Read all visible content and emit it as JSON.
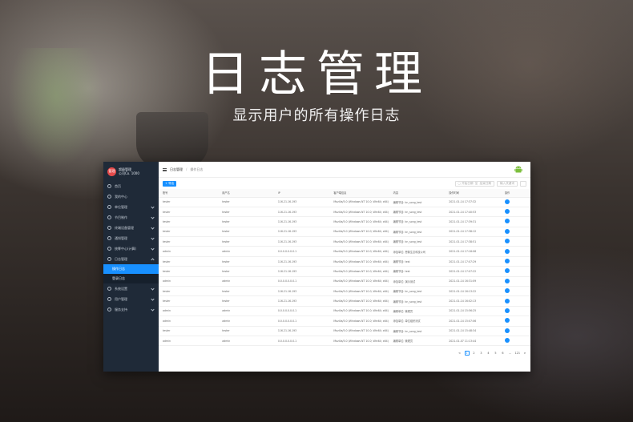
{
  "hero": {
    "title": "日志管理",
    "subtitle": "显示用户的所有操作日志"
  },
  "user": {
    "avatar": "管理",
    "name": "超级管理",
    "role": "公司Co. 1000"
  },
  "sidebar": {
    "items": [
      {
        "label": "首页"
      },
      {
        "label": "我的中心"
      },
      {
        "label": "单位管理"
      },
      {
        "label": "节目制作"
      },
      {
        "label": "终端设备管理"
      },
      {
        "label": "通知管理"
      },
      {
        "label": "统筹中心(计算)"
      },
      {
        "label": "日志管理"
      }
    ],
    "sub": [
      {
        "label": "操作日志"
      },
      {
        "label": "登录日志"
      }
    ],
    "items2": [
      {
        "label": "系统设置"
      },
      {
        "label": "用户管理"
      },
      {
        "label": "服务支持"
      }
    ]
  },
  "breadcrumb": {
    "first": "日志管理",
    "sep": "/",
    "second": "操作日志"
  },
  "toolbar": {
    "export_label": "+ 导出",
    "start_placeholder": "开始日期",
    "to_label": "至",
    "end_placeholder": "结束日期",
    "search_placeholder": "输入关键词"
  },
  "table": {
    "headers": [
      "账号",
      "用户名",
      "IP",
      "客户端信息",
      "内容",
      "操作时间",
      "操作"
    ],
    "rows": [
      [
        "tester",
        "tester",
        "116.21.16.193",
        "Mozilla/5.0 (Windows NT 10.0; Win64; x64) App...",
        "编辑节目: kn_song_test",
        "2021-01-14 17:37:32"
      ],
      [
        "tester",
        "tester",
        "116.21.16.193",
        "Mozilla/5.0 (Windows NT 10.0; Win64; x64) App...",
        "编辑节目: kn_song_test",
        "2021-01-14 17:40:53"
      ],
      [
        "tester",
        "tester",
        "116.21.16.193",
        "Mozilla/5.0 (Windows NT 10.0; Win64; x64) App...",
        "编辑节目: kn_song_test",
        "2021-01-14 17:39:31"
      ],
      [
        "tester",
        "tester",
        "116.21.16.193",
        "Mozilla/5.0 (Windows NT 10.0; Win64; x64) App...",
        "编辑节目: kn_song_test",
        "2021-01-14 17:38:12"
      ],
      [
        "tester",
        "tester",
        "116.21.16.193",
        "Mozilla/5.0 (Windows NT 10.0; Win64; x64) App...",
        "编辑节目: kn_song_test",
        "2021-01-14 17:38:51"
      ],
      [
        "admin",
        "admin",
        "0.0.0.0.0.0.0.1",
        "Mozilla/5.0 (Windows NT 10.0; Win64; x64) App...",
        "添加单位: 恩普生意科技公司",
        "2021-01-14 17:18:06"
      ],
      [
        "tester",
        "tester",
        "116.21.16.193",
        "Mozilla/5.0 (Windows NT 10.0; Win64; x64) App...",
        "编辑节目: test",
        "2021-01-14 17:07:29"
      ],
      [
        "tester",
        "tester",
        "116.21.16.193",
        "Mozilla/5.0 (Windows NT 10.0; Win64; x64) App...",
        "编辑节目: test",
        "2021-01-14 17:07:22"
      ],
      [
        "admin",
        "admin",
        "0.0.0.0.0.0.0.1",
        "Mozilla/5.0 (Windows NT 10.0; Win64; x64) App...",
        "添加单位: 演示测试",
        "2021-01-14 16:31:09"
      ],
      [
        "tester",
        "tester",
        "116.21.16.193",
        "Mozilla/5.0 (Windows NT 10.0; Win64; x64) App...",
        "编辑节目: kn_song_test",
        "2021-01-14 16:13:22"
      ],
      [
        "tester",
        "tester",
        "116.21.16.193",
        "Mozilla/5.0 (Windows NT 10.0; Win64; x64) App...",
        "编辑节目: kn_song_test",
        "2021-01-14 16:02:13"
      ],
      [
        "admin",
        "admin",
        "0.0.0.0.0.0.0.1",
        "Mozilla/5.0 (Windows NT 10.0; Win64; x64) App...",
        "编辑单位: 管理员",
        "2021-01-14 15:56:25"
      ],
      [
        "admin",
        "admin",
        "0.0.0.0.0.0.0.1",
        "Mozilla/5.0 (Windows NT 10.0; Win64; x64) App...",
        "添加单位: 单位组织测试",
        "2021-01-14 15:07:06"
      ],
      [
        "tester",
        "tester",
        "116.21.16.193",
        "Mozilla/5.0 (Windows NT 10.0; Win64; x64) App...",
        "编辑节目: kn_song_test",
        "2021-01-14 15:48:34"
      ],
      [
        "admin",
        "admin",
        "0.0.0.0.0.0.0.1",
        "Mozilla/5.0 (Windows NT 10.0; Win64; x64) App...",
        "编辑单位: 管理员",
        "2021-01-07 11:13:44"
      ]
    ]
  },
  "pager": [
    "<",
    "1",
    "2",
    "3",
    "4",
    "5",
    "6",
    "...",
    "121",
    ">"
  ],
  "colors": {
    "accent": "#1890ff",
    "sidebar": "#1f2a38",
    "android": "#7cbf3c"
  },
  "icons": {
    "logo": "android-icon",
    "menu": "hamburger-icon"
  }
}
